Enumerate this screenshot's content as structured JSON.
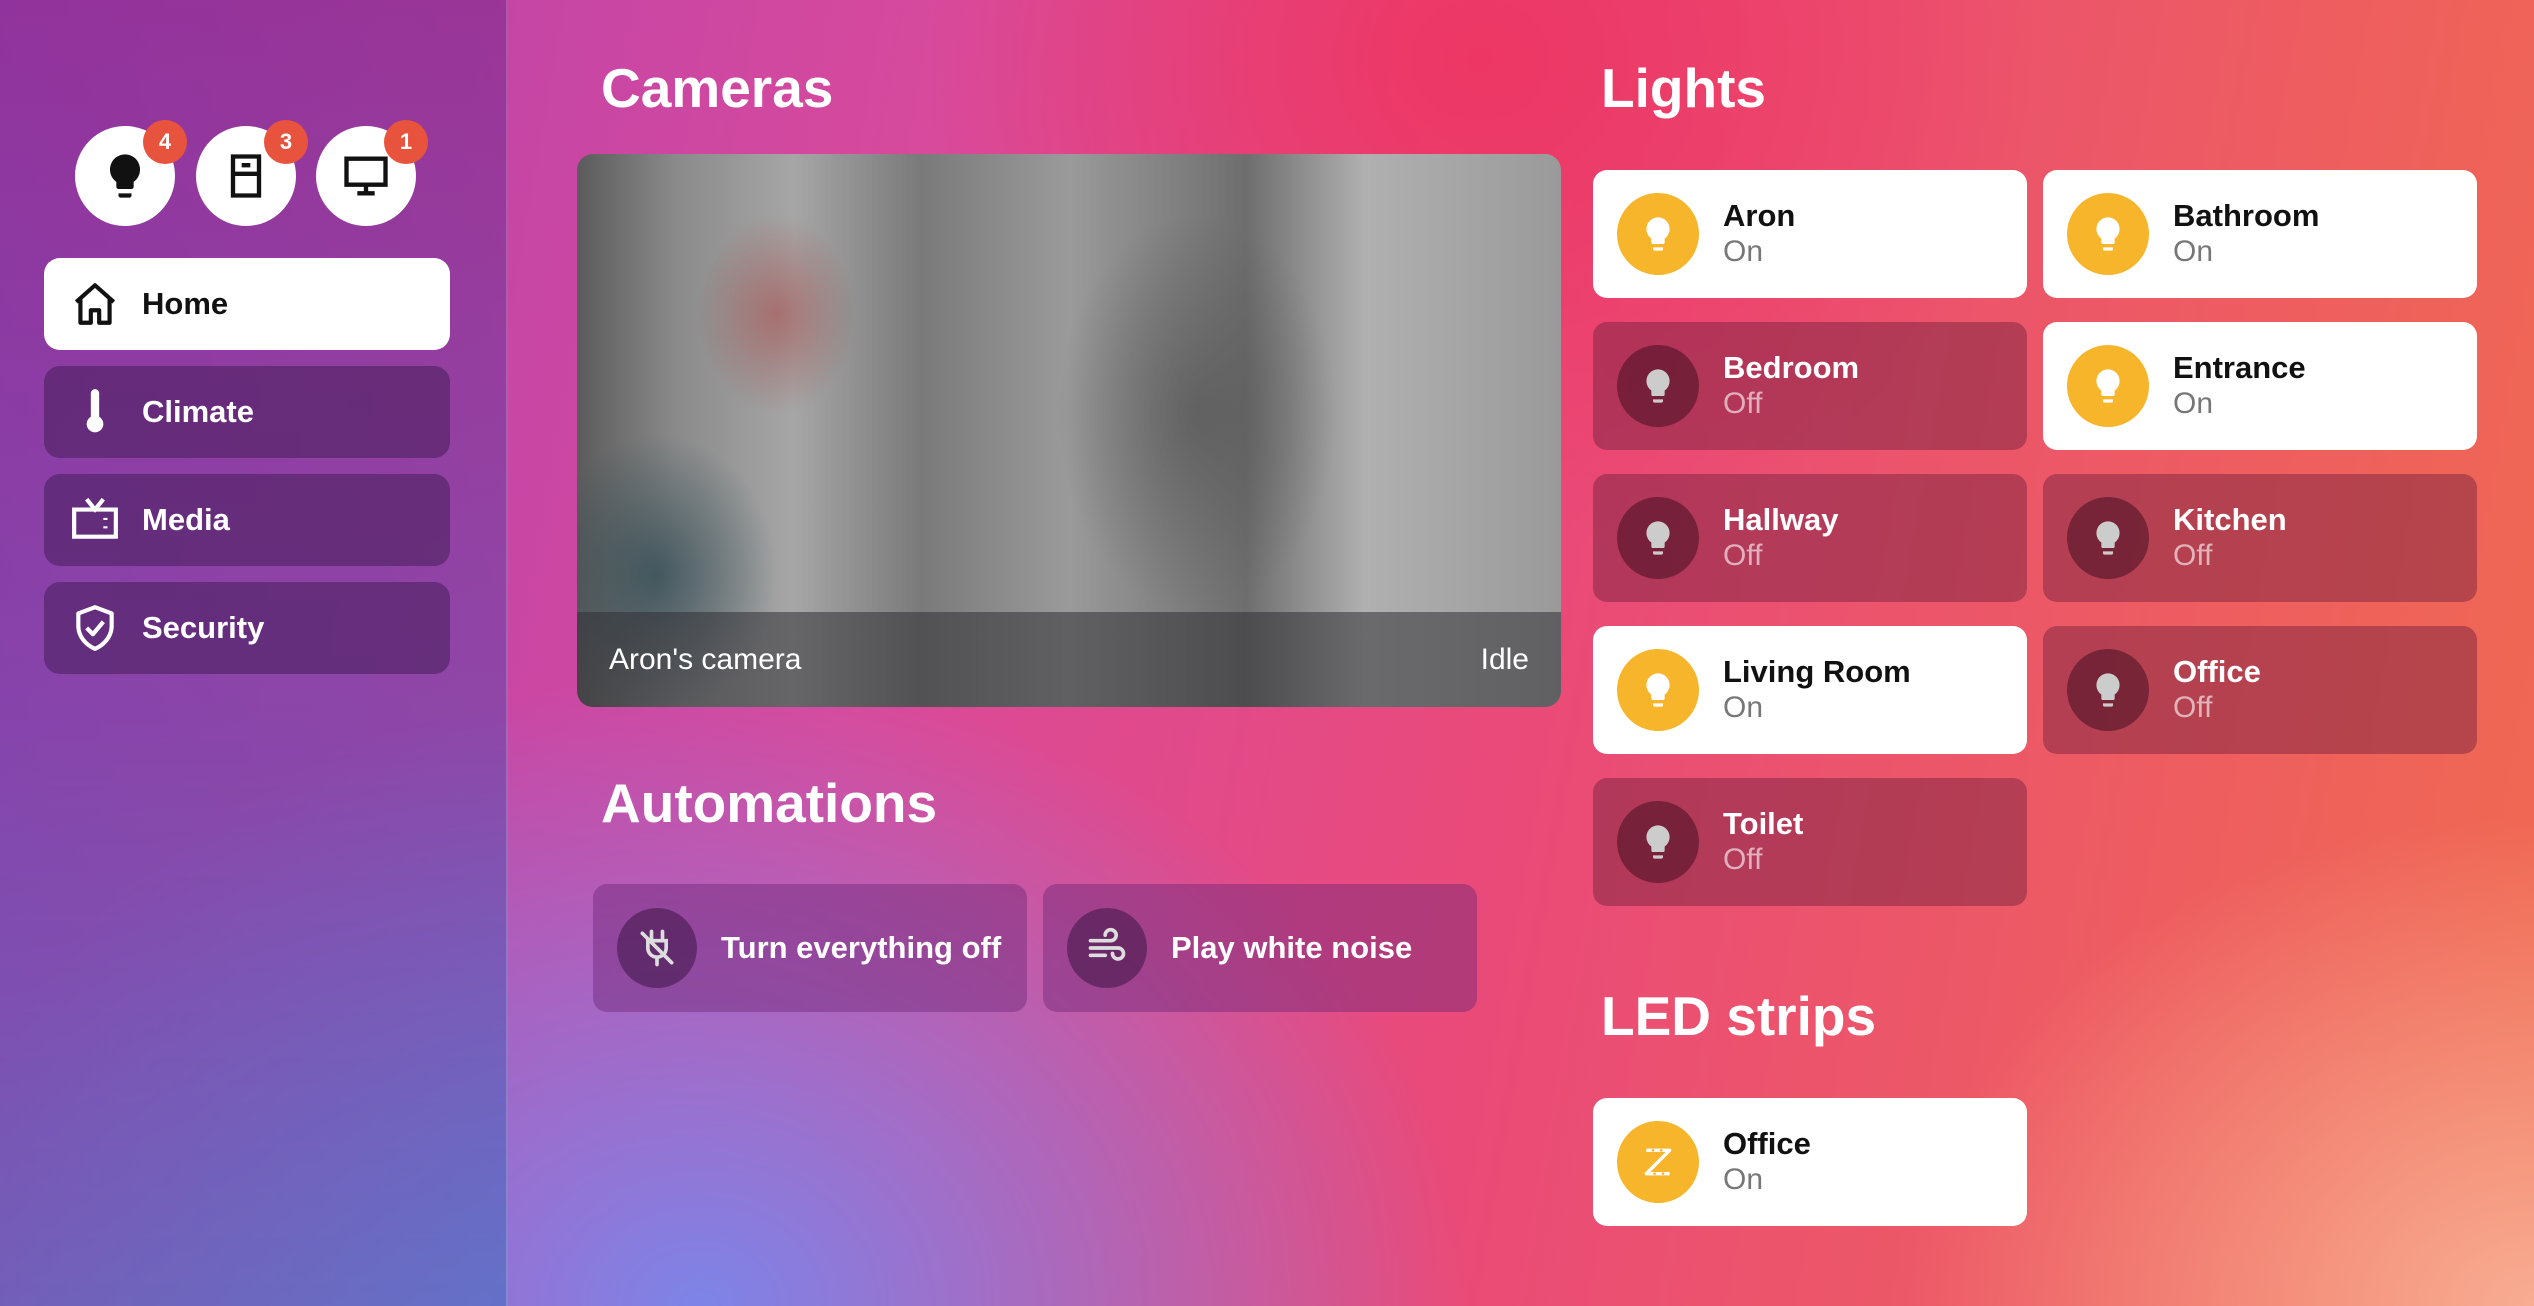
{
  "sidebar": {
    "chips": [
      {
        "icon": "lightbulb-icon",
        "count": "4"
      },
      {
        "icon": "door-icon",
        "count": "3"
      },
      {
        "icon": "monitor-icon",
        "count": "1"
      }
    ],
    "nav": [
      {
        "label": "Home",
        "icon": "home-icon",
        "active": true
      },
      {
        "label": "Climate",
        "icon": "thermometer-icon",
        "active": false
      },
      {
        "label": "Media",
        "icon": "tv-icon",
        "active": false
      },
      {
        "label": "Security",
        "icon": "shield-check-icon",
        "active": false
      }
    ]
  },
  "cameras": {
    "title": "Cameras",
    "camera_name": "Aron's camera",
    "camera_state": "Idle"
  },
  "automations": {
    "title": "Automations",
    "items": [
      {
        "label": "Turn everything off",
        "icon": "power-plug-off-icon"
      },
      {
        "label": "Play white noise",
        "icon": "wind-icon"
      }
    ]
  },
  "lights": {
    "title": "Lights",
    "items": [
      {
        "name": "Aron",
        "state": "On"
      },
      {
        "name": "Bathroom",
        "state": "On"
      },
      {
        "name": "Bedroom",
        "state": "Off"
      },
      {
        "name": "Entrance",
        "state": "On"
      },
      {
        "name": "Hallway",
        "state": "Off"
      },
      {
        "name": "Kitchen",
        "state": "Off"
      },
      {
        "name": "Living Room",
        "state": "On"
      },
      {
        "name": "Office",
        "state": "Off"
      },
      {
        "name": "Toilet",
        "state": "Off"
      }
    ]
  },
  "led_strips": {
    "title": "LED strips",
    "items": [
      {
        "name": "Office",
        "state": "On"
      }
    ]
  },
  "colors": {
    "on_icon_bg": "#f7b52c",
    "badge": "#e8533e"
  }
}
